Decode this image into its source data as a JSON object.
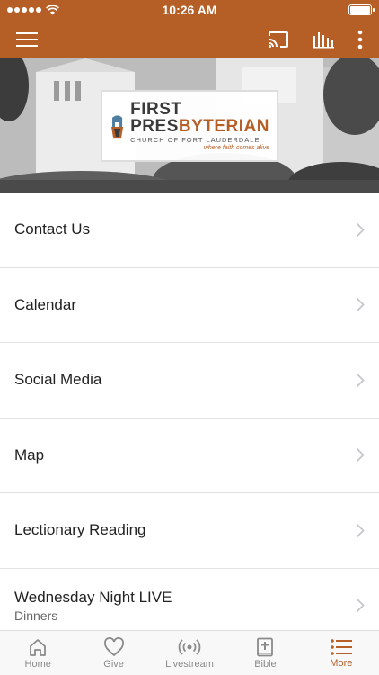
{
  "status_bar": {
    "time": "10:26 AM"
  },
  "colors": {
    "brand": "#b55e25",
    "text": "#222222",
    "muted": "#8a8a8a",
    "chevron": "#c7c7cc"
  },
  "toolbar": {
    "menu_icon": "hamburger-icon",
    "cast_icon": "cast-icon",
    "audio_icon": "audio-bars-icon",
    "more_icon": "vertical-dots-icon"
  },
  "hero": {
    "logo": {
      "line1": "FIRST",
      "line2_a": "PRES",
      "line2_b": "BYTERIAN",
      "subtitle": "CHURCH OF FORT LAUDERDALE",
      "tagline": "where faith comes alive"
    }
  },
  "menu": {
    "items": [
      {
        "label": "Contact Us",
        "sub": ""
      },
      {
        "label": "Calendar",
        "sub": ""
      },
      {
        "label": "Social Media",
        "sub": ""
      },
      {
        "label": "Map",
        "sub": ""
      },
      {
        "label": "Lectionary Reading",
        "sub": ""
      },
      {
        "label": "Wednesday Night LIVE",
        "sub": "Dinners"
      }
    ]
  },
  "tabbar": {
    "tabs": [
      {
        "label": "Home",
        "icon": "home-icon"
      },
      {
        "label": "Give",
        "icon": "heart-icon"
      },
      {
        "label": "Livestream",
        "icon": "broadcast-icon"
      },
      {
        "label": "Bible",
        "icon": "bible-icon"
      },
      {
        "label": "More",
        "icon": "list-icon",
        "active": true
      }
    ]
  }
}
